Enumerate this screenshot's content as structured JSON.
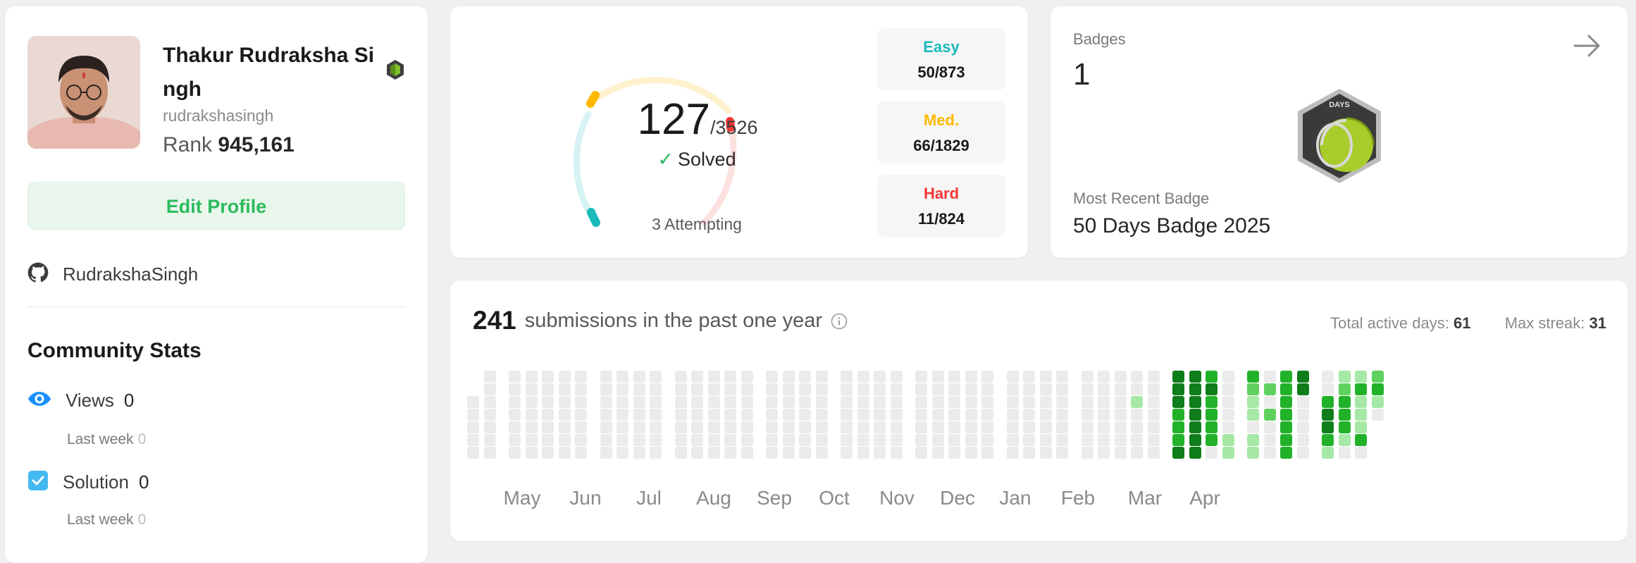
{
  "profile": {
    "name": "Thakur Rudraksha Si ngh",
    "username": "rudrakshasingh",
    "rank_label": "Rank",
    "rank_value": "945,161",
    "edit_button": "Edit Profile",
    "github_name": "RudrakshaSingh",
    "github_icon": "github-icon",
    "level_badge_icon": "level-badge-icon"
  },
  "community": {
    "title": "Community Stats",
    "stats": [
      {
        "label": "Views",
        "value": "0",
        "last_week_label": "Last week",
        "last_week_value": "0",
        "icon": "eye-icon"
      },
      {
        "label": "Solution",
        "value": "0",
        "last_week_label": "Last week",
        "last_week_value": "0",
        "icon": "checkbox-icon"
      }
    ]
  },
  "solved": {
    "count": "127",
    "total": "/3526",
    "label": "Solved",
    "attempting": "3 Attempting",
    "difficulties": [
      {
        "label": "Easy",
        "value": "50/873",
        "color": "#1cbaba"
      },
      {
        "label": "Med.",
        "value": "66/1829",
        "color": "#ffb800"
      },
      {
        "label": "Hard",
        "value": "11/824",
        "color": "#f63737"
      }
    ]
  },
  "badges": {
    "label": "Badges",
    "count": "1",
    "recent_label": "Most Recent Badge",
    "recent_name": "50 Days Badge 2025",
    "badge_text": "DAYS"
  },
  "submissions": {
    "count": "241",
    "text": "submissions in the past one year",
    "active_days_label": "Total active days:",
    "active_days_value": "61",
    "max_streak_label": "Max streak:",
    "max_streak_value": "31",
    "months": [
      "May",
      "Jun",
      "Jul",
      "Aug",
      "Sep",
      "Oct",
      "Nov",
      "Dec",
      "Jan",
      "Feb",
      "Mar",
      "Apr"
    ]
  },
  "colors": {
    "accent_green": "#2cbb5d",
    "empty_cell": "#ebebeb",
    "green_levels": [
      "#a6e8a6",
      "#5fd15f",
      "#22b22a",
      "#0f7d1a"
    ]
  }
}
